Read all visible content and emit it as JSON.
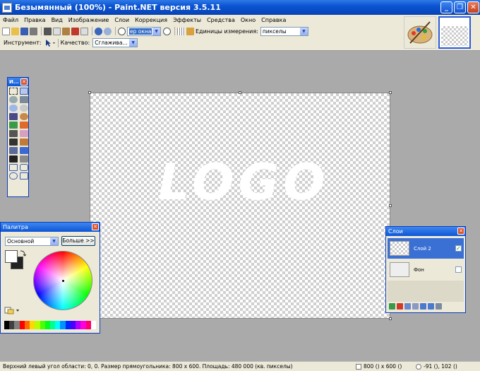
{
  "window": {
    "title": "Безымянный (100%) - Paint.NET версия 3.5.11",
    "minimize_label": "_",
    "maximize_label": "❐",
    "close_label": "✕"
  },
  "menu": [
    "Файл",
    "Правка",
    "Вид",
    "Изображение",
    "Слои",
    "Коррекция",
    "Эффекты",
    "Средства",
    "Окно",
    "Справка"
  ],
  "toolbar": {
    "zoom_value": "ер окна",
    "units_label": "Единицы измерения:",
    "units_value": "пикселы",
    "tool_label": "Инструмент:",
    "quality_label": "Качество:",
    "quality_value": "Сглажива..."
  },
  "canvas": {
    "logo_text": "LOGO"
  },
  "tools_window": {
    "title": "И...",
    "close_label": "✕"
  },
  "palette_window": {
    "title": "Палитра",
    "close_label": "✕",
    "mode_value": "Основной",
    "more_button": "Больше >>",
    "primary_color": "#ffffff",
    "secondary_color": "#222222",
    "strip_colors": [
      "#000000",
      "#404040",
      "#808080",
      "#ff0000",
      "#ff6a00",
      "#ffd800",
      "#b6ff00",
      "#4cff00",
      "#00ff21",
      "#00ff90",
      "#00ffff",
      "#0094ff",
      "#0026ff",
      "#4800ff",
      "#b200ff",
      "#ff00dc",
      "#ff006e",
      "#ffffff"
    ]
  },
  "layers_window": {
    "title": "Слои",
    "close_label": "✕",
    "layers": [
      {
        "name": "Слой 2",
        "visible_mark": "✓"
      },
      {
        "name": "Фон",
        "visible_mark": ""
      }
    ]
  },
  "status": {
    "main": "Верхний левый угол области: 0, 0. Размер прямоугольника: 800 x 600. Площадь: 480 000 (кв. пикселы)",
    "size": "800 () x 600 ()",
    "pos": "-91 (), 102 ()"
  },
  "colors": {
    "titlebar": "#0a54d4",
    "workspace": "#aaaaaa",
    "chrome": "#ece9d8",
    "layer_selected": "#3a6fd4"
  }
}
